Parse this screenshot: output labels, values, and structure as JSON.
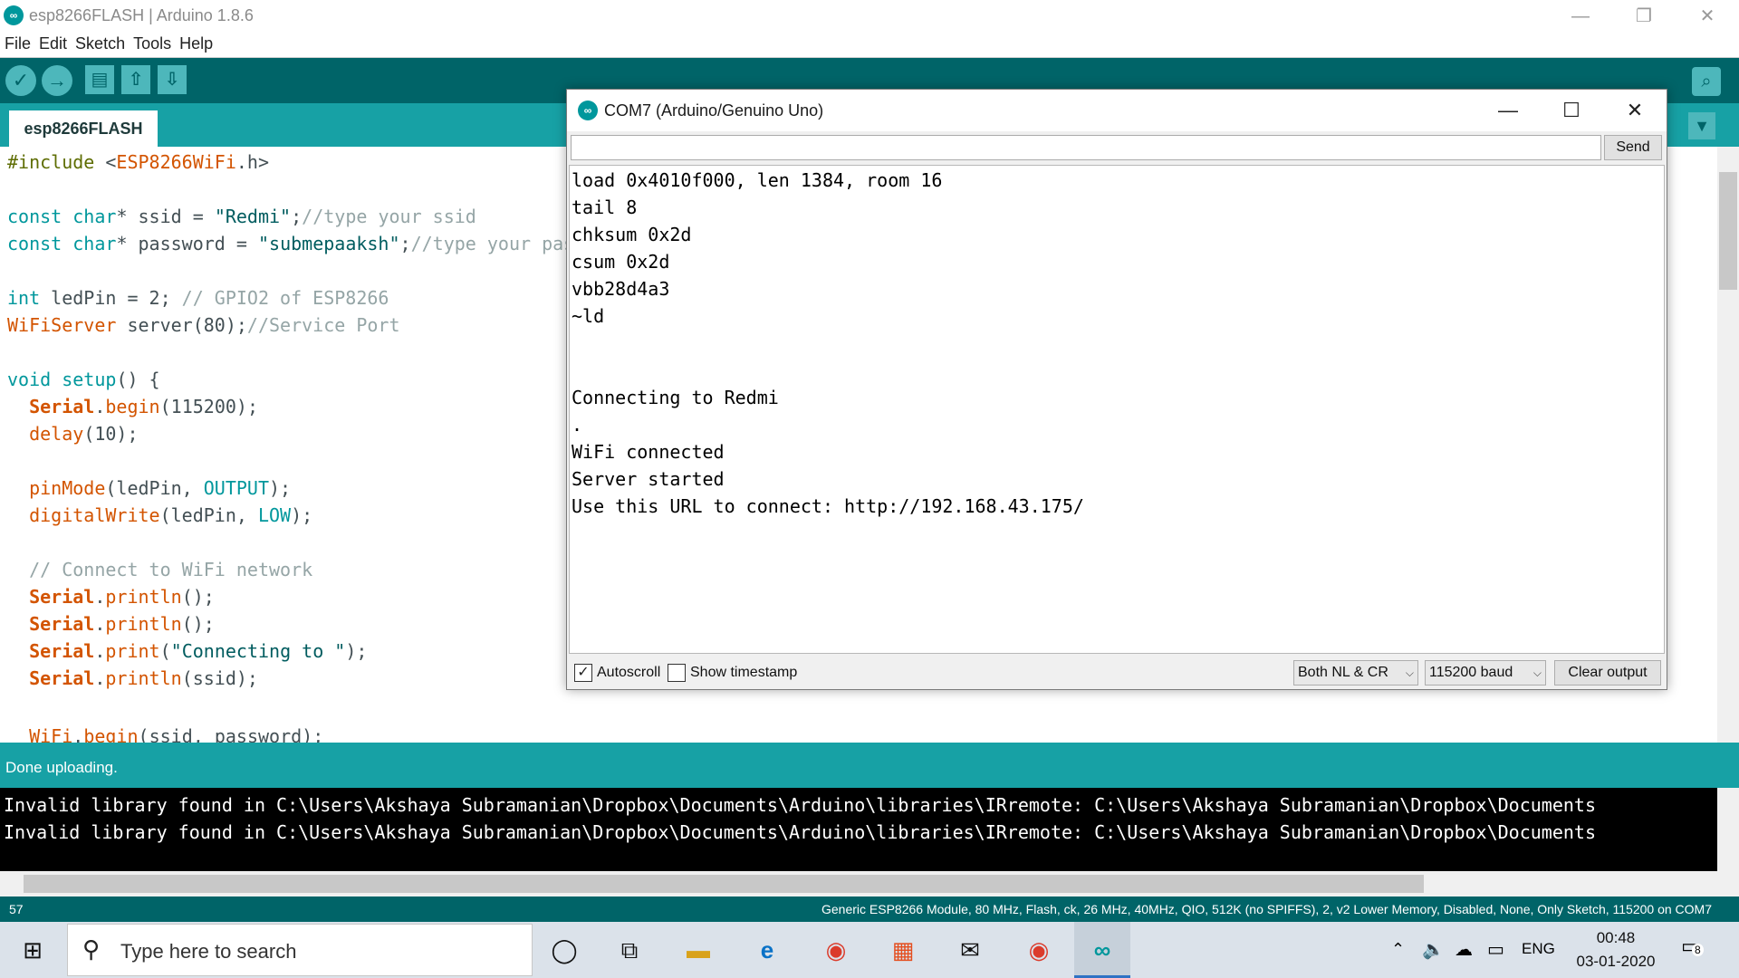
{
  "window": {
    "title": "esp8266FLASH | Arduino 1.8.6",
    "logo": "∞",
    "minimize": "—",
    "restore": "❐",
    "close": "✕"
  },
  "menu": [
    "File",
    "Edit",
    "Sketch",
    "Tools",
    "Help"
  ],
  "toolbar": {
    "verify_icon": "check-icon",
    "upload_icon": "arrow-right-icon",
    "new_icon": "document-icon",
    "open_icon": "arrow-up-icon",
    "save_icon": "arrow-down-icon",
    "serial_icon": "magnifier-icon"
  },
  "tab": {
    "label": "esp8266FLASH"
  },
  "status": {
    "message": "Done uploading."
  },
  "console": [
    "Invalid library found in C:\\Users\\Akshaya Subramanian\\Dropbox\\Documents\\Arduino\\libraries\\IRremote: C:\\Users\\Akshaya Subramanian\\Dropbox\\Documents",
    "Invalid library found in C:\\Users\\Akshaya Subramanian\\Dropbox\\Documents\\Arduino\\libraries\\IRremote: C:\\Users\\Akshaya Subramanian\\Dropbox\\Documents"
  ],
  "footer": {
    "line": "57",
    "board": "Generic ESP8266 Module, 80 MHz, Flash, ck, 26 MHz, 40MHz, QIO, 512K (no SPIFFS), 2, v2 Lower Memory, Disabled, None, Only Sketch, 115200 on COM7"
  },
  "serial_monitor": {
    "title": "COM7 (Arduino/Genuino Uno)",
    "send_label": "Send",
    "input_value": "",
    "output": [
      "load 0x4010f000, len 1384, room 16",
      "tail 8",
      "chksum 0x2d",
      "csum 0x2d",
      "vbb28d4a3",
      "~ld",
      "",
      "",
      "Connecting to Redmi",
      ".",
      "WiFi connected",
      "Server started",
      "Use this URL to connect: http://192.168.43.175/"
    ],
    "autoscroll_label": "Autoscroll",
    "autoscroll_checked": true,
    "timestamp_label": "Show timestamp",
    "timestamp_checked": false,
    "line_ending": "Both NL & CR",
    "baud": "115200 baud",
    "clear_label": "Clear output"
  },
  "taskbar": {
    "search_placeholder": "Type here to search",
    "language": "ENG",
    "time": "00:48",
    "date": "03-01-2020",
    "notifications": "8"
  }
}
